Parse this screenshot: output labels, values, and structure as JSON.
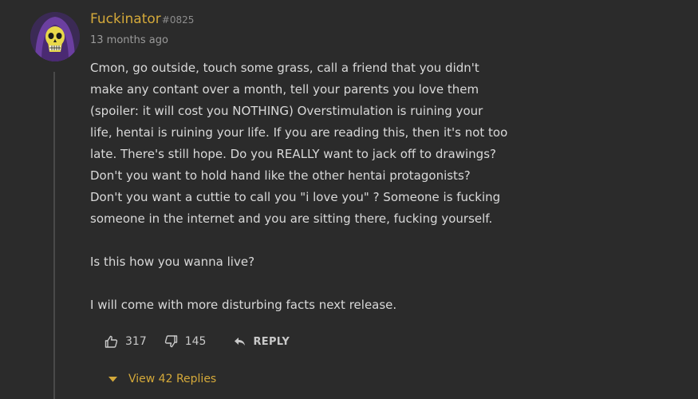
{
  "comment": {
    "username": "Fuckinator",
    "discriminator": "#0825",
    "timestamp": "13 months ago",
    "paragraphs": [
      "Cmon, go outside, touch some grass, call a friend that you didn't\nmake any contant over a month, tell your parents you love them\n(spoiler: it will cost you NOTHING) Overstimulation is ruining your\nlife, hentai is ruining your life. If you are reading this, then it's not too\nlate. There's still hope. Do you REALLY want to jack off to drawings?\nDon't you want to hold hand like the other hentai protagonists?\nDon't you want a cuttie to call you \"i love you\" ? Someone is fucking\nsomeone in the internet and you are sitting there, fucking yourself.",
      "Is this how you wanna live?",
      "I will come with more disturbing facts next release."
    ],
    "likes": "317",
    "dislikes": "145",
    "reply_label": "REPLY",
    "view_replies_label": "View 42 Replies"
  },
  "icons": {
    "avatar": "skeletor-avatar",
    "like": "thumbs-up-icon",
    "dislike": "thumbs-down-icon",
    "reply": "reply-arrow-icon",
    "expand": "caret-down-icon"
  },
  "colors": {
    "background": "#2b2b2b",
    "username": "#d4a93a",
    "text": "#d9d9d9",
    "muted": "#9a9a9a",
    "accent": "#d4a93a"
  }
}
